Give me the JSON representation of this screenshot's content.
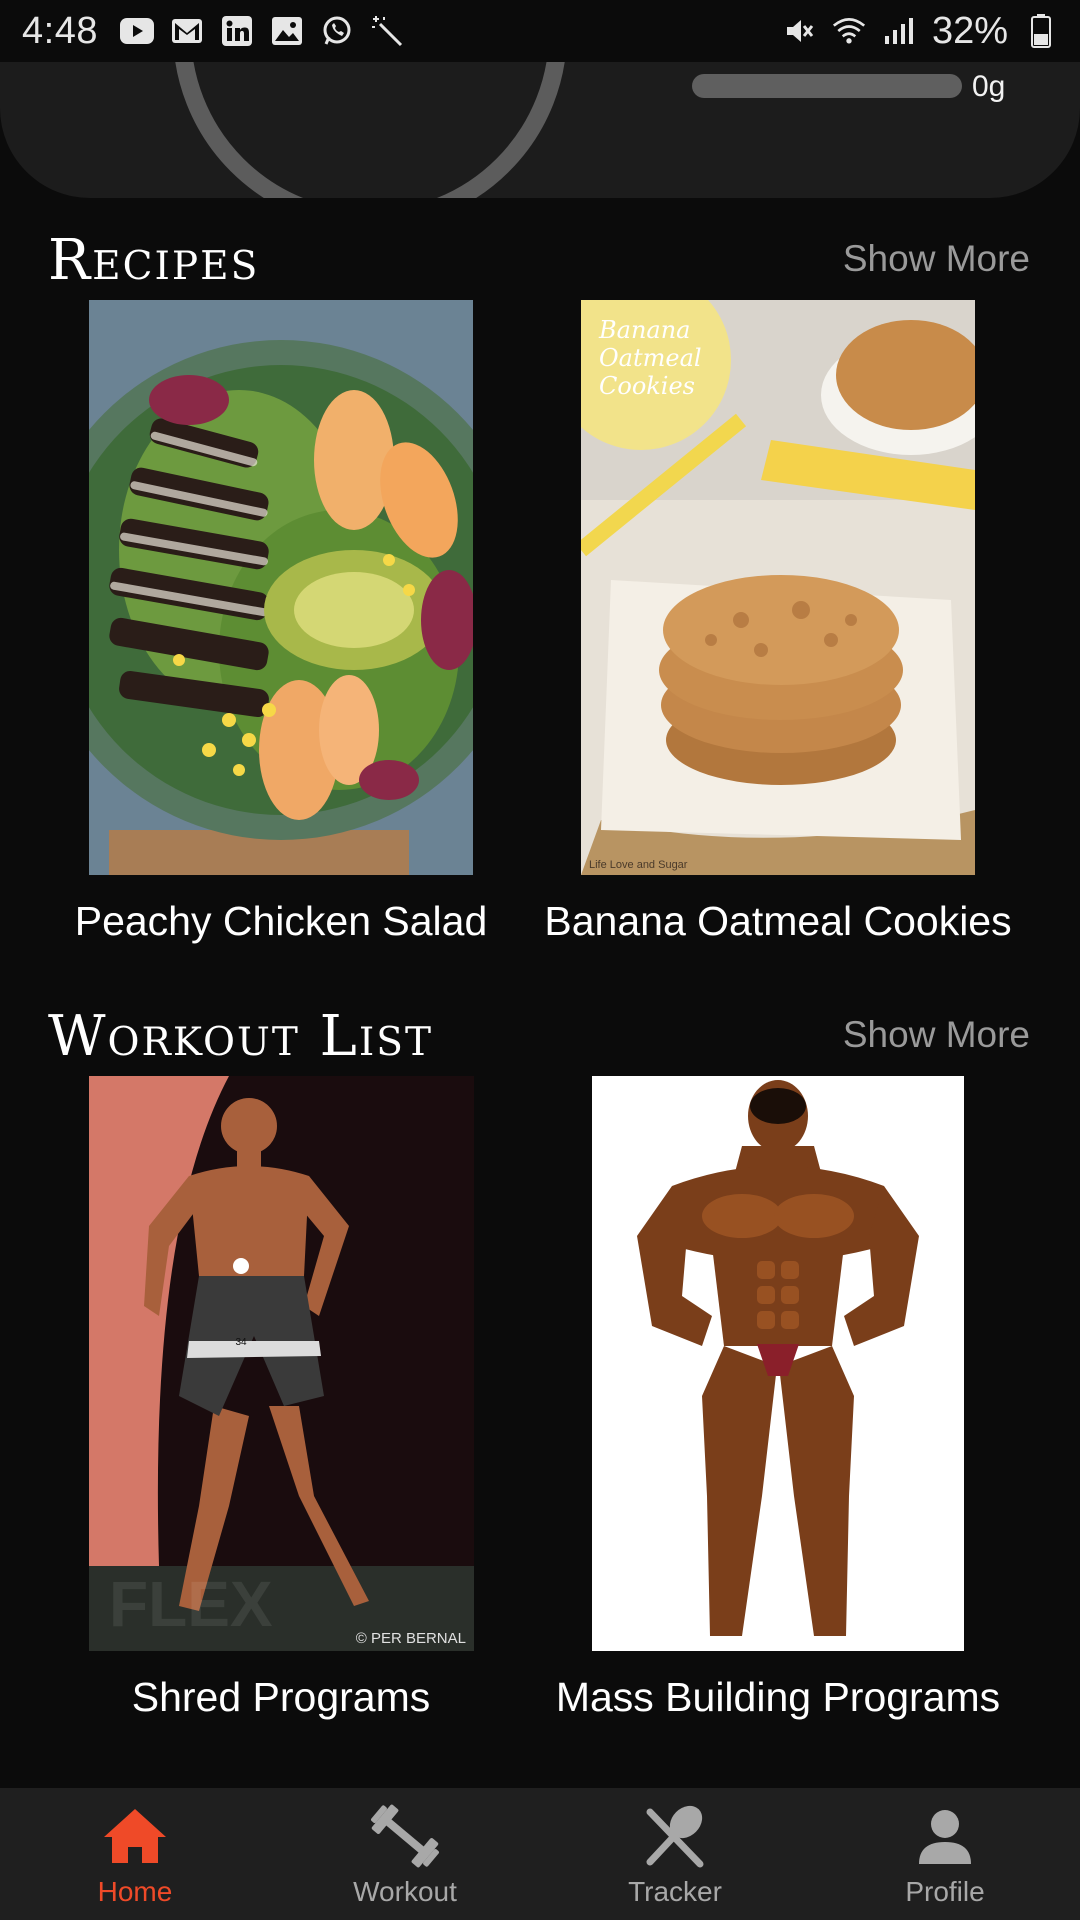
{
  "status_bar": {
    "time": "4:48",
    "battery": "32%",
    "left_icons": [
      "youtube-icon",
      "gmail-icon",
      "linkedin-icon",
      "gallery-icon",
      "whatsapp-icon",
      "magic-wand-icon"
    ],
    "right_icons": [
      "mute-icon",
      "wifi-icon",
      "signal-icon",
      "battery-icon"
    ]
  },
  "summary": {
    "macro_value": "0g"
  },
  "recipes": {
    "title": "Recipes",
    "show_more": "Show More",
    "items": [
      {
        "label": "Peachy Chicken Salad"
      },
      {
        "label": "Banana Oatmeal Cookies",
        "image_caption": "Banana Oatmeal Cookies",
        "credit": "Life Love and Sugar"
      }
    ]
  },
  "workouts": {
    "title": "Workout List",
    "show_more": "Show More",
    "items": [
      {
        "label": "Shred Programs",
        "badge": "34",
        "watermark": "FLEX",
        "credit": "© PER BERNAL"
      },
      {
        "label": "Mass Building Programs"
      }
    ]
  },
  "bottom_nav": {
    "items": [
      {
        "label": "Home",
        "icon": "home-icon",
        "active": true
      },
      {
        "label": "Workout",
        "icon": "dumbbell-icon",
        "active": false
      },
      {
        "label": "Tracker",
        "icon": "utensils-icon",
        "active": false
      },
      {
        "label": "Profile",
        "icon": "person-icon",
        "active": false
      }
    ]
  },
  "colors": {
    "accent": "#ef4a28",
    "background": "#0b0b0b",
    "card": "#1c1c1c",
    "nav_bg": "#1f1f1f",
    "muted_text": "#9a9a9a"
  }
}
